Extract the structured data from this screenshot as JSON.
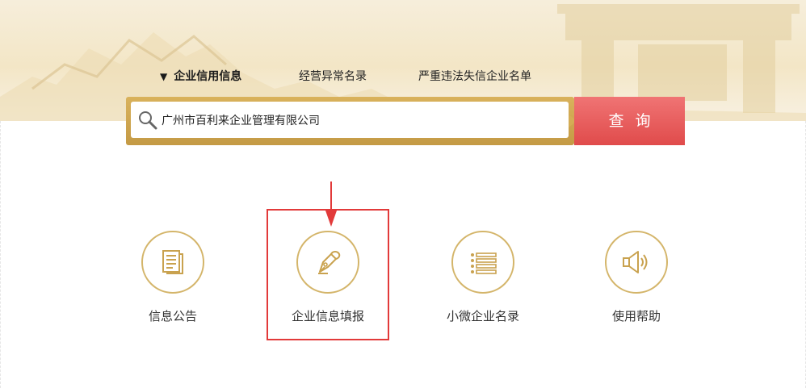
{
  "tabs": {
    "active_marker": "▼",
    "items": [
      {
        "label": "企业信用信息",
        "active": true
      },
      {
        "label": "经营异常名录",
        "active": false
      },
      {
        "label": "严重违法失信企业名单",
        "active": false
      }
    ]
  },
  "search": {
    "value": "广州市百利来企业管理有限公司",
    "button_label": "查询"
  },
  "features": [
    {
      "label": "信息公告",
      "icon": "document-icon"
    },
    {
      "label": "企业信息填报",
      "icon": "pen-nib-icon",
      "highlighted": true
    },
    {
      "label": "小微企业名录",
      "icon": "list-icon"
    },
    {
      "label": "使用帮助",
      "icon": "speaker-icon"
    }
  ],
  "colors": {
    "gold": "#d4b56a",
    "search_frame": "#c9a14d",
    "search_button": "#e85a5a",
    "highlight": "#e23a3a"
  }
}
